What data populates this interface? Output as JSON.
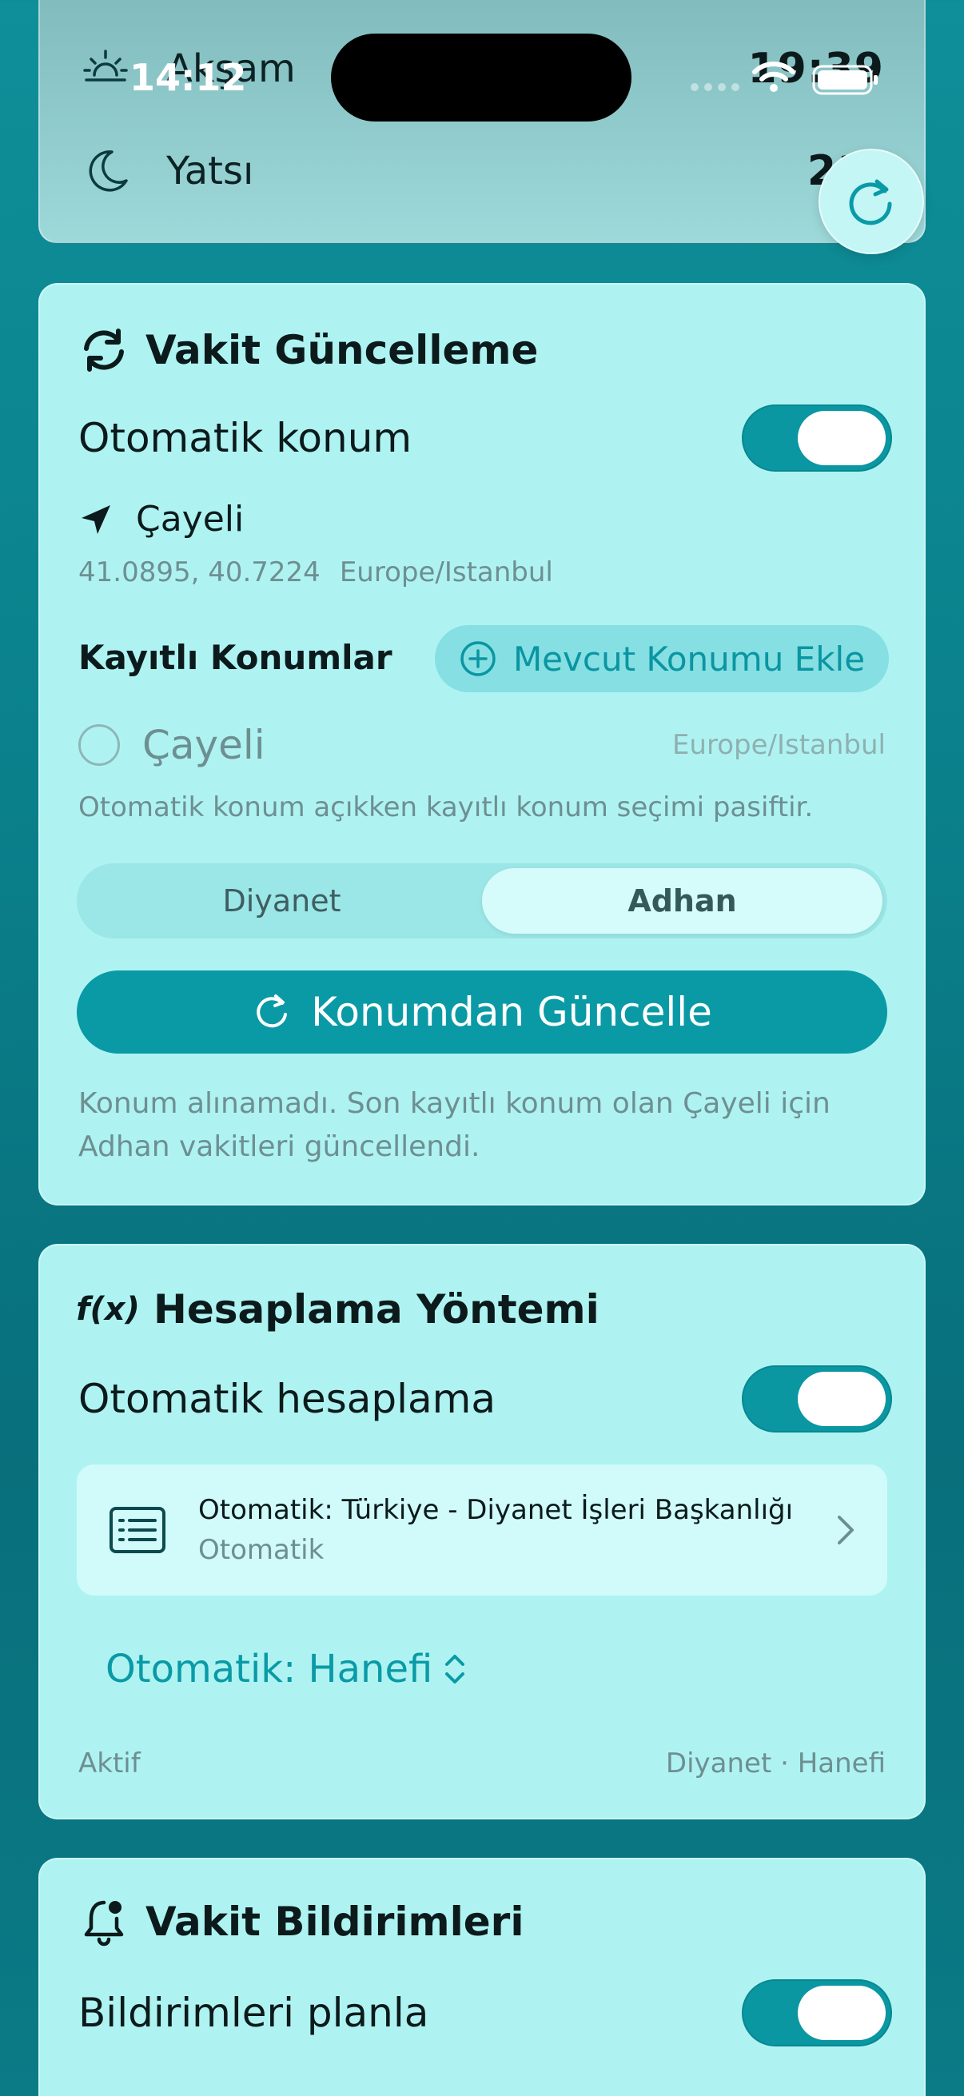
{
  "status_bar": {
    "time": "14:12"
  },
  "prayers": [
    {
      "name": "Akşam",
      "time": "19:39",
      "icon": "sunset-icon"
    },
    {
      "name": "Yatsı",
      "time": "21:",
      "icon": "moon-icon"
    }
  ],
  "location_card": {
    "title": "Vakit Güncelleme",
    "auto_location_label": "Otomatik konum",
    "current_location": "Çayeli",
    "coords": "41.0895, 40.7224",
    "timezone": "Europe/Istanbul",
    "saved_title": "Kayıtlı Konumlar",
    "add_button": "Mevcut Konumu Ekle",
    "saved": [
      {
        "name": "Çayeli",
        "timezone": "Europe/Istanbul"
      }
    ],
    "auto_note": "Otomatik konum açıkken kayıtlı konum seçimi pasiftir.",
    "segments": [
      "Diyanet",
      "Adhan"
    ],
    "selected_segment": "Adhan",
    "update_button": "Konumdan Güncelle",
    "update_message": "Konum alınamadı. Son kayıtlı konum olan Çayeli için Adhan vakitleri güncellendi."
  },
  "method_card": {
    "title": "Hesaplama Yöntemi",
    "icon_text": "f(x)",
    "auto_calc_label": "Otomatik hesaplama",
    "method_title": "Otomatik: Türkiye - Diyanet İşleri Başkanlığı",
    "method_sub": "Otomatik",
    "madhab": "Otomatik: Hanefi",
    "status": "Aktif",
    "summary": "Diyanet · Hanefi"
  },
  "notif_card": {
    "title": "Vakit Bildirimleri",
    "schedule_label": "Bildirimleri planla"
  },
  "colors": {
    "accent": "#0a9aa6",
    "card": "#aef3f2",
    "background": "#0a7f8a"
  }
}
